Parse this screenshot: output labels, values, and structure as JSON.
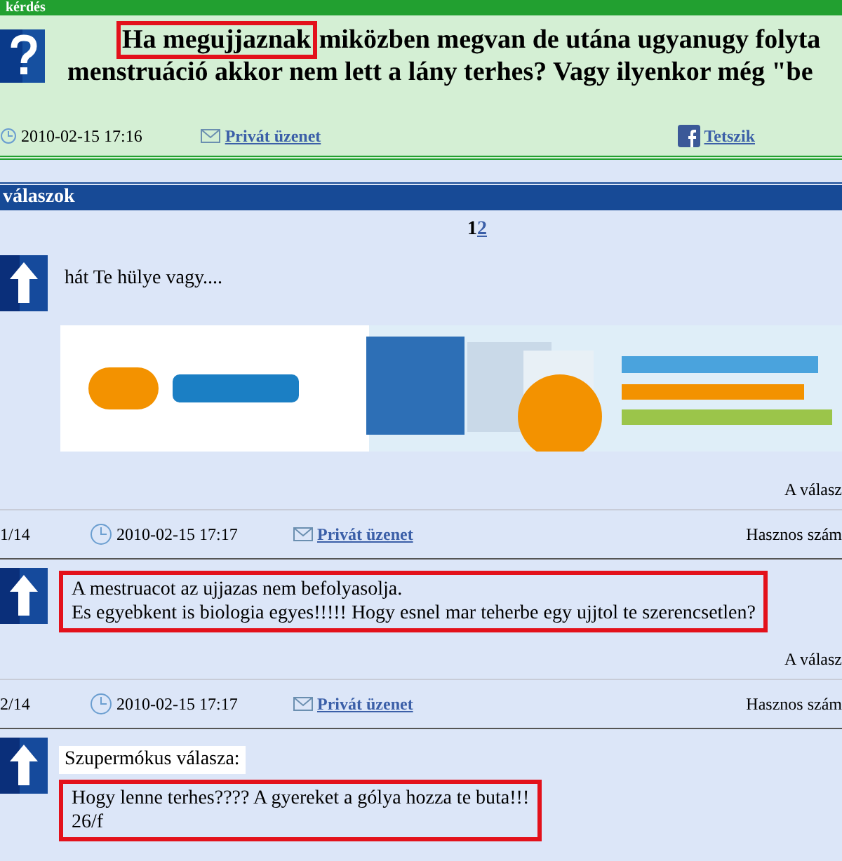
{
  "question": {
    "header": "kérdés",
    "title_highlight": "Ha megujjaznak",
    "title_rest": "miközben megvan de utána ugyanugy folyta",
    "title_line2": "menstruáció akkor nem lett a lány terhes? Vagy ilyenkor még \"be",
    "date": "2010-02-15 17:16",
    "message_link": "Privát üzenet",
    "like_link": "Tetszik"
  },
  "answers_header": "válaszok",
  "pages": [
    {
      "label": "1",
      "selected": true
    },
    {
      "label": "2",
      "selected": false
    }
  ],
  "posts": [
    {
      "lines": [
        "hát Te hülye vagy...."
      ],
      "highlighted": false,
      "banner": {
        "kind": "picture"
      },
      "footer": "A válasz",
      "meta": {
        "number": "1/14",
        "date": "2010-02-15 17:17",
        "message_link": "Privát üzenet",
        "rating": "Hasznos szám"
      }
    },
    {
      "lines": [
        "A mestruacot az ujjazas nem befolyasolja.",
        "Es egyebkent is biologia egyes!!!!! Hogy esnel mar teherbe egy ujjtol te szerencsetlen?"
      ],
      "highlighted": true,
      "footer": "A válasz",
      "meta": {
        "number": "2/14",
        "date": "2010-02-15 17:17",
        "message_link": "Privát üzenet",
        "rating": "Hasznos szám"
      }
    },
    {
      "author": "Szupermókus válasza:",
      "lines": [
        "Hogy lenne terhes???? A gyereket a gólya hozza te buta!!!",
        "26/f"
      ],
      "highlighted": true
    }
  ]
}
